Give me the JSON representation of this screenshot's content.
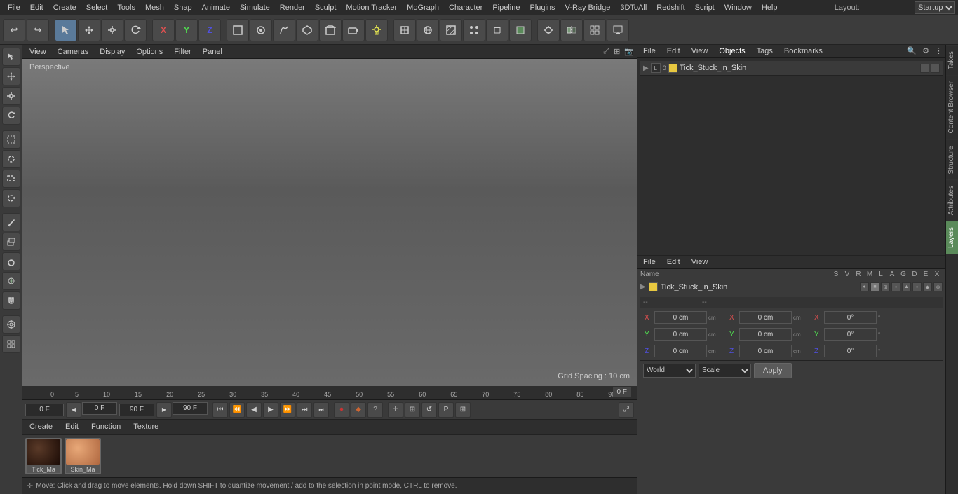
{
  "menu": {
    "items": [
      "File",
      "Edit",
      "Create",
      "Select",
      "Tools",
      "Mesh",
      "Snap",
      "Animate",
      "Simulate",
      "Render",
      "Sculpt",
      "Motion Tracker",
      "MoGraph",
      "Character",
      "Pipeline",
      "Plugins",
      "V-Ray Bridge",
      "3DToAll",
      "Redshift",
      "Script",
      "Window",
      "Help"
    ],
    "layout_label": "Layout:",
    "layout_value": "Startup"
  },
  "toolbar": {
    "undo_icon": "↩",
    "redo_icon": "↪",
    "move_icon": "✛",
    "scale_icon": "⊞",
    "rotate_icon": "↺",
    "x_axis": "X",
    "y_axis": "Y",
    "z_axis": "Z",
    "poly_icon": "□",
    "new_icon": "◻",
    "cube_icon": "■"
  },
  "viewport": {
    "tab_label": "Perspective",
    "menu_items": [
      "View",
      "Cameras",
      "Display",
      "Options",
      "Filter",
      "Panel"
    ],
    "grid_spacing": "Grid Spacing : 10 cm"
  },
  "timeline": {
    "current_frame": "0 F",
    "start_frame": "0 F",
    "end_frame": "90 F",
    "max_frame": "90 F",
    "frame_indicator": "0 F",
    "ticks": [
      "0",
      "5",
      "10",
      "15",
      "20",
      "25",
      "30",
      "35",
      "40",
      "45",
      "50",
      "55",
      "60",
      "65",
      "70",
      "75",
      "80",
      "85",
      "90"
    ]
  },
  "object_manager": {
    "menus": [
      "File",
      "Edit",
      "View"
    ],
    "object_name": "Tick_Stuck_in_Skin",
    "color_hex": "#e8c840"
  },
  "attributes": {
    "menus": [
      "File",
      "Edit",
      "View"
    ],
    "columns": [
      "Name",
      "S",
      "V",
      "R",
      "M",
      "L",
      "A",
      "G",
      "D",
      "E",
      "X"
    ],
    "item_name": "Tick_Stuck_in_Skin",
    "color_hex": "#e8c840"
  },
  "transform": {
    "sections": [
      "--",
      "--"
    ],
    "x_pos": "0 cm",
    "y_pos": "0 cm",
    "z_pos": "0 cm",
    "x_rot": "0°",
    "y_rot": "0°",
    "z_rot": "0°",
    "x_scale": "0 cm",
    "y_scale": "0 cm",
    "z_scale": "0 cm",
    "x_rot2": "0°",
    "y_rot2": "0°",
    "z_rot2": "0°"
  },
  "coord_bar": {
    "world_label": "World",
    "scale_label": "Scale",
    "apply_label": "Apply"
  },
  "materials": {
    "menus": [
      "Create",
      "Edit",
      "Function",
      "Texture"
    ],
    "items": [
      {
        "name": "Tick_Ma",
        "color": "#3a2a1a"
      },
      {
        "name": "Skin_Ma",
        "color": "#c8906a"
      }
    ]
  },
  "status": {
    "text": "Move: Click and drag to move elements. Hold down SHIFT to quantize movement / add to the selection in point mode, CTRL to remove."
  },
  "right_tabs": [
    "Takes",
    "Content Browser",
    "Structure",
    "Attributes",
    "Layers"
  ],
  "om_top": {
    "object_name": "Tick_Stuck_in_Skin",
    "color": "#e8c840"
  }
}
